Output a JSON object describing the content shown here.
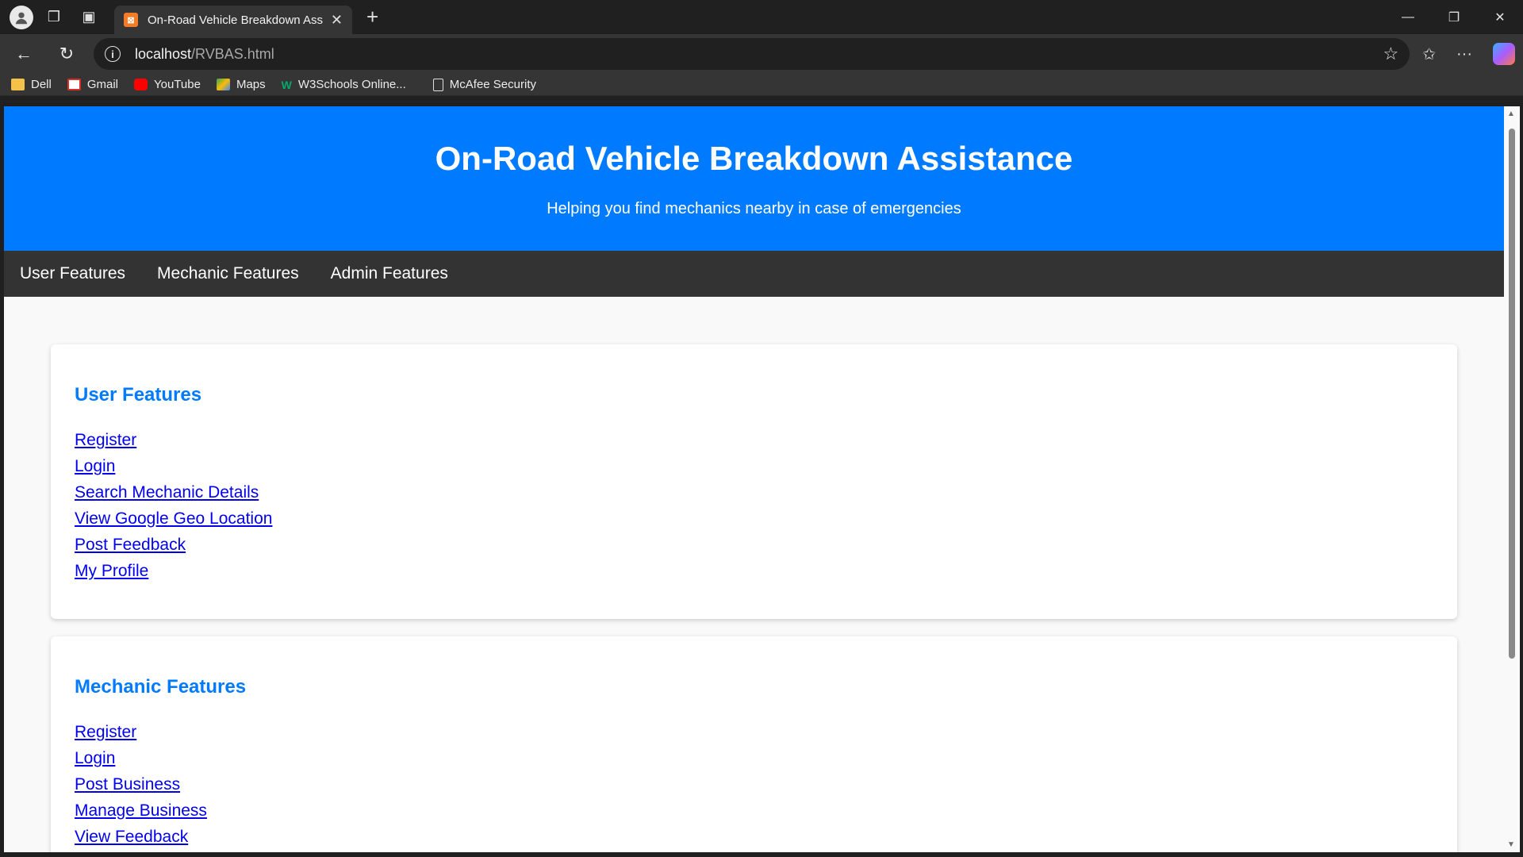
{
  "browser": {
    "tab_title": "On-Road Vehicle Breakdown Assi",
    "url_host": "localhost",
    "url_path": "/RVBAS.html",
    "bookmarks": [
      "Dell",
      "Gmail",
      "YouTube",
      "Maps",
      "W3Schools Online...",
      "McAfee Security"
    ]
  },
  "header": {
    "title": "On-Road Vehicle Breakdown Assistance",
    "subtitle": "Helping you find mechanics nearby in case of emergencies"
  },
  "nav": [
    "User Features",
    "Mechanic Features",
    "Admin Features"
  ],
  "sections": [
    {
      "heading": "User Features",
      "links": [
        "Register",
        "Login",
        "Search Mechanic Details",
        "View Google Geo Location",
        "Post Feedback",
        "My Profile"
      ]
    },
    {
      "heading": "Mechanic Features",
      "links": [
        "Register",
        "Login",
        "Post Business",
        "Manage Business",
        "View Feedback"
      ]
    }
  ]
}
